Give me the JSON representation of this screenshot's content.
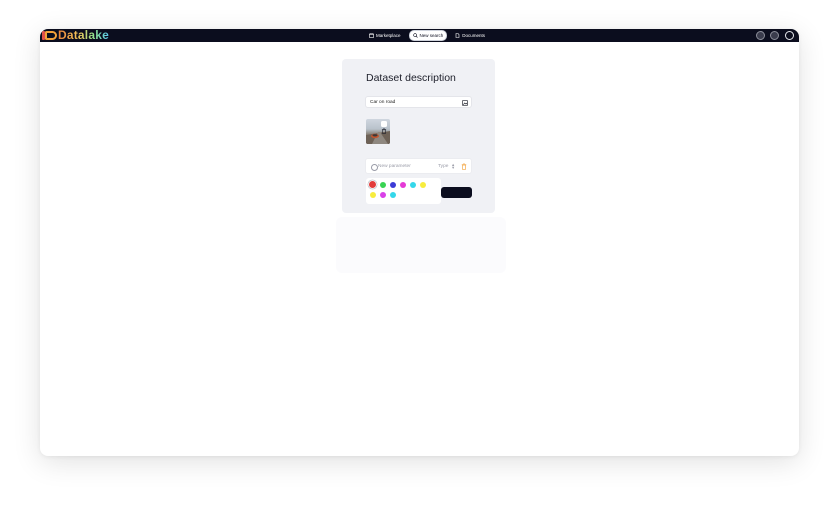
{
  "app": {
    "logo_text": "Datalake"
  },
  "nav": {
    "items": [
      {
        "label": "Marketplace",
        "icon": "store-icon",
        "active": false
      },
      {
        "label": "New search",
        "icon": "search-icon",
        "active": true
      },
      {
        "label": "Documents",
        "icon": "document-icon",
        "active": false
      }
    ]
  },
  "header_icons": [
    "settings-icon",
    "notifications-icon",
    "user-avatar"
  ],
  "form": {
    "title": "Dataset description",
    "search": {
      "value": "Car on road",
      "icon": "image-upload-icon"
    },
    "image_thumbnail": {
      "alt": "car on road photo",
      "action_icon": "trash-icon"
    },
    "parameter": {
      "placeholder": "New parameter",
      "type_label": "Type",
      "delete_icon": "trash-icon"
    },
    "palette": {
      "colors": [
        "#e23b3b",
        "#39d353",
        "#3d3bd6",
        "#e53ad6",
        "#35d7ea",
        "#f7ec3e",
        "#f7ec3e",
        "#d941e8",
        "#35d7ea"
      ],
      "selected_index": 0
    },
    "submit_label": ""
  },
  "colors": {
    "topbar": "#0b0d1e",
    "card_bg": "#f0f1f5",
    "accent_orange": "#f2a13a"
  }
}
